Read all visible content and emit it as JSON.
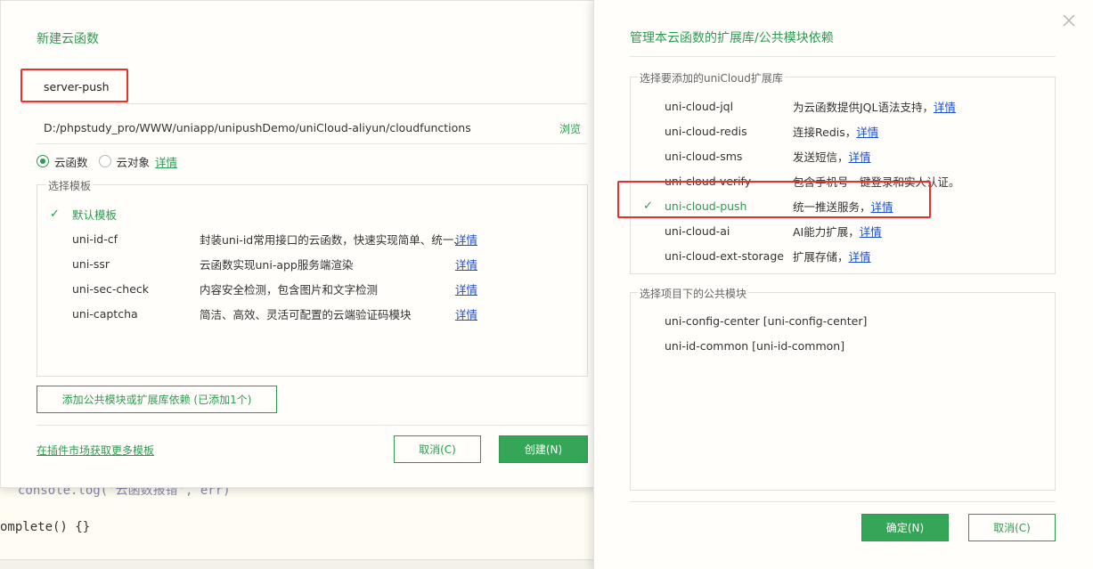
{
  "editor": {
    "code_line_1": "console.log('云函数报错', err)",
    "code_line_2": "omplete() {}"
  },
  "left_dialog": {
    "title": "新建云函数",
    "name_value": "server-push",
    "path": "D:/phpstudy_pro/WWW/uniapp/unipushDemo/uniCloud-aliyun/cloudfunctions",
    "browse_label": "浏览",
    "radio_cloud_function": "云函数",
    "radio_cloud_object": "云对象",
    "details_link": "详情",
    "template_legend": "选择模板",
    "templates": [
      {
        "name": "默认模板",
        "desc": "",
        "link": ""
      },
      {
        "name": "uni-id-cf",
        "desc": "封装uni-id常用接口的云函数，快速实现简单、统一、",
        "link": "详情"
      },
      {
        "name": "uni-ssr",
        "desc": "云函数实现uni-app服务端渲染",
        "link": "详情"
      },
      {
        "name": "uni-sec-check",
        "desc": "内容安全检测，包含图片和文字检测",
        "link": "详情"
      },
      {
        "name": "uni-captcha",
        "desc": "简洁、高效、灵活可配置的云端验证码模块",
        "link": "详情"
      }
    ],
    "add_deps_button": "添加公共模块或扩展库依赖 (已添加1个)",
    "market_link": "在插件市场获取更多模板",
    "cancel_button": "取消(C)",
    "create_button": "创建(N)"
  },
  "right_dialog": {
    "title": "管理本云函数的扩展库/公共模块依赖",
    "ext_legend": "选择要添加的uniCloud扩展库",
    "extensions": [
      {
        "name": "uni-cloud-jql",
        "desc": "为云函数提供JQL语法支持，",
        "link": "详情",
        "checked": false
      },
      {
        "name": "uni-cloud-redis",
        "desc": "连接Redis，",
        "link": "详情",
        "checked": false
      },
      {
        "name": "uni-cloud-sms",
        "desc": "发送短信，",
        "link": "详情",
        "checked": false
      },
      {
        "name": "uni-cloud-verify",
        "desc": "包含手机号一键登录和实人认证。",
        "link": "",
        "checked": false
      },
      {
        "name": "uni-cloud-push",
        "desc": "统一推送服务，",
        "link": "详情",
        "checked": true
      },
      {
        "name": "uni-cloud-ai",
        "desc": "AI能力扩展，",
        "link": "详情",
        "checked": false
      },
      {
        "name": "uni-cloud-ext-storage",
        "desc": "扩展存储，",
        "link": "详情",
        "checked": false
      }
    ],
    "modules_legend": "选择项目下的公共模块",
    "modules": [
      "uni-config-center [uni-config-center]",
      "uni-id-common [uni-id-common]"
    ],
    "ok_button": "确定(N)",
    "cancel_button": "取消(C)"
  },
  "colors": {
    "accent": "#2e9a50",
    "highlight_box": "#e8312d",
    "link_blue": "#1a4fd1"
  }
}
